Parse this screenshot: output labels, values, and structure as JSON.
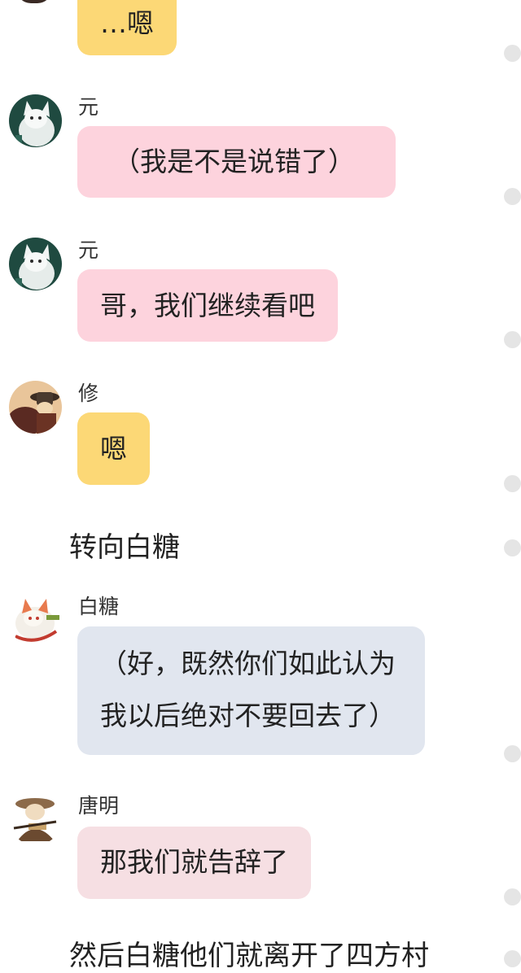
{
  "messages": [
    {
      "type": "bubble",
      "name": "",
      "text": "…嗯",
      "color": "yellow"
    },
    {
      "type": "bubble",
      "name": "元",
      "text": "（我是不是说错了）",
      "color": "pink"
    },
    {
      "type": "bubble",
      "name": "元",
      "text": "哥，我们继续看吧",
      "color": "pink"
    },
    {
      "type": "bubble",
      "name": "修",
      "text": "嗯",
      "color": "yellow"
    },
    {
      "type": "narration",
      "text": "转向白糖"
    },
    {
      "type": "bubble",
      "name": "白糖",
      "lines": [
        "（好，既然你们如此认为",
        "我以后绝对不要回去了）"
      ],
      "color": "blue"
    },
    {
      "type": "bubble",
      "name": "唐明",
      "text": "那我们就告辞了",
      "color": "rose"
    },
    {
      "type": "narration",
      "text": "然后白糖他们就离开了四方村"
    }
  ],
  "colors": {
    "yellow": "#fcd876",
    "pink": "#fdd3dd",
    "blue": "#e1e6ef",
    "rose": "#f6dfe3",
    "scroll_dot": "#e5e5e5"
  },
  "icons": [
    "wolf-avatar-icon",
    "monk-avatar-icon",
    "fox-avatar-icon",
    "scholar-avatar-icon"
  ]
}
